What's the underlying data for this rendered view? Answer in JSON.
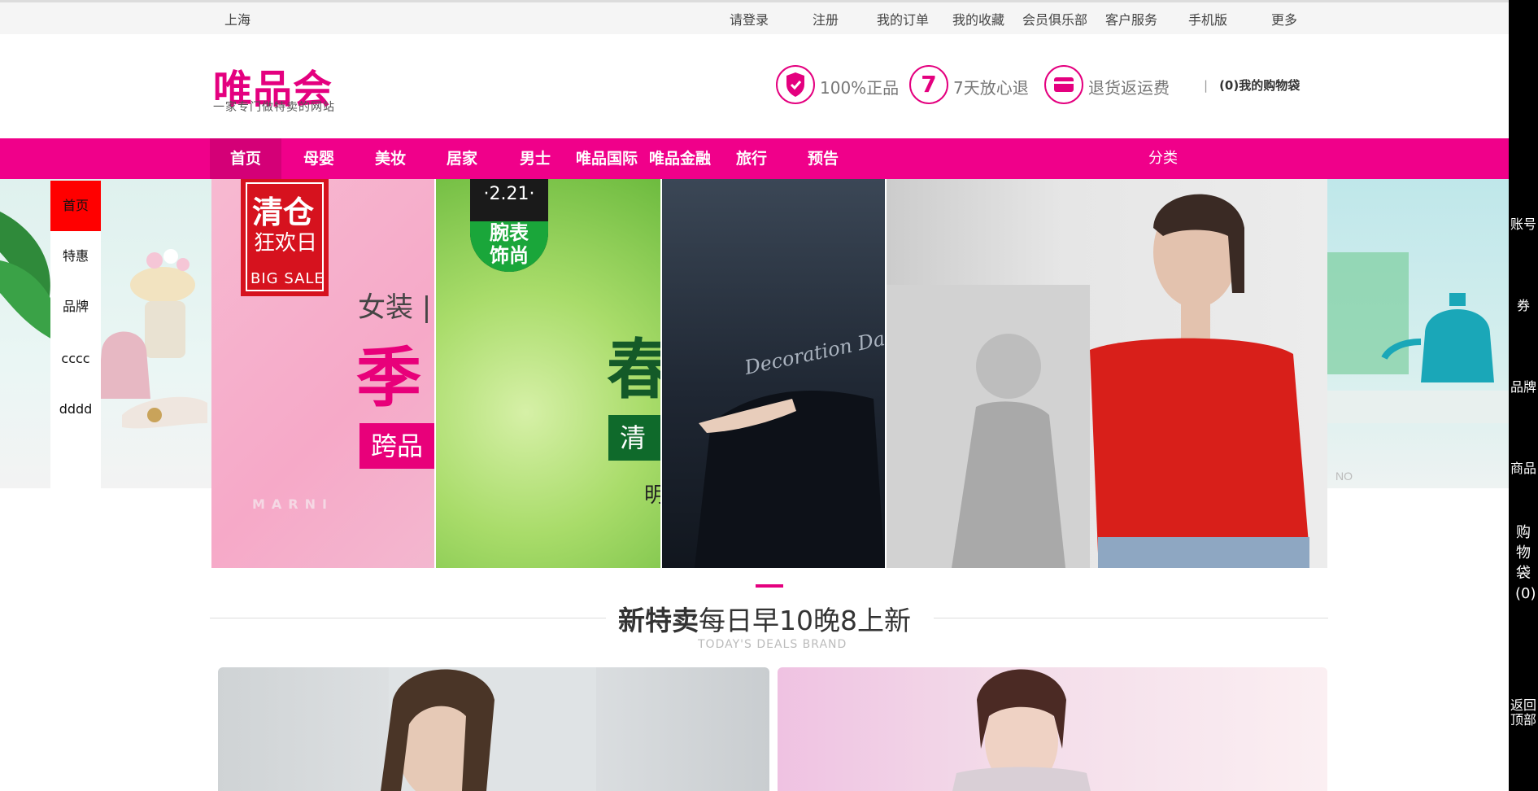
{
  "topbar": {
    "city": "上海",
    "links": [
      "请登录",
      "注册",
      "我的订单",
      "我的收藏",
      "会员俱乐部",
      "客户服务",
      "手机版",
      "更多"
    ]
  },
  "header": {
    "logo": "唯品会",
    "slogan": "一家专门做特卖的网站",
    "badges": [
      {
        "icon": "shield-check-icon",
        "text": "100%正品"
      },
      {
        "icon": "seven-day-icon",
        "text": "7天放心退",
        "glyph": "7"
      },
      {
        "icon": "card-refund-icon",
        "text": "退货返运费"
      }
    ],
    "cart_separator": "|",
    "cart": "(0)我的购物袋"
  },
  "nav": {
    "items": [
      "首页",
      "母婴",
      "美妆",
      "居家",
      "男士",
      "唯品国际",
      "唯品金融",
      "旅行",
      "预告"
    ],
    "category": "分类",
    "active_index": 0
  },
  "left_menu": {
    "items": [
      "首页",
      "特惠",
      "品牌",
      "cccc",
      "dddd"
    ],
    "active_index": 0
  },
  "right_bar": {
    "items": [
      "账号",
      "券",
      "品牌",
      "商品",
      "购物袋(0)",
      "返回顶部"
    ]
  },
  "banner": {
    "panel1": {
      "badge_line1": "清仓",
      "badge_line2": "狂欢日",
      "badge_line3": "BIG SALE",
      "text1": "女装 |",
      "text2": "季",
      "button": "跨品",
      "brand": "MARNI"
    },
    "panel2": {
      "date": "·2.21·",
      "tag": "腕表饰尚",
      "text1": "春",
      "button": "清",
      "text2": "明"
    },
    "panel3": {
      "script": "Decoration Da"
    },
    "panel4": {},
    "side_right": {
      "text": "NO"
    }
  },
  "section": {
    "title_bold": "新特卖",
    "title_rest": "每日早10晚8上新",
    "subtitle": "TODAY'S DEALS BRAND"
  },
  "colors": {
    "brand_pink": "#e4007f",
    "nav_pink": "#f0008a",
    "left_menu_active": "#ff0000"
  }
}
